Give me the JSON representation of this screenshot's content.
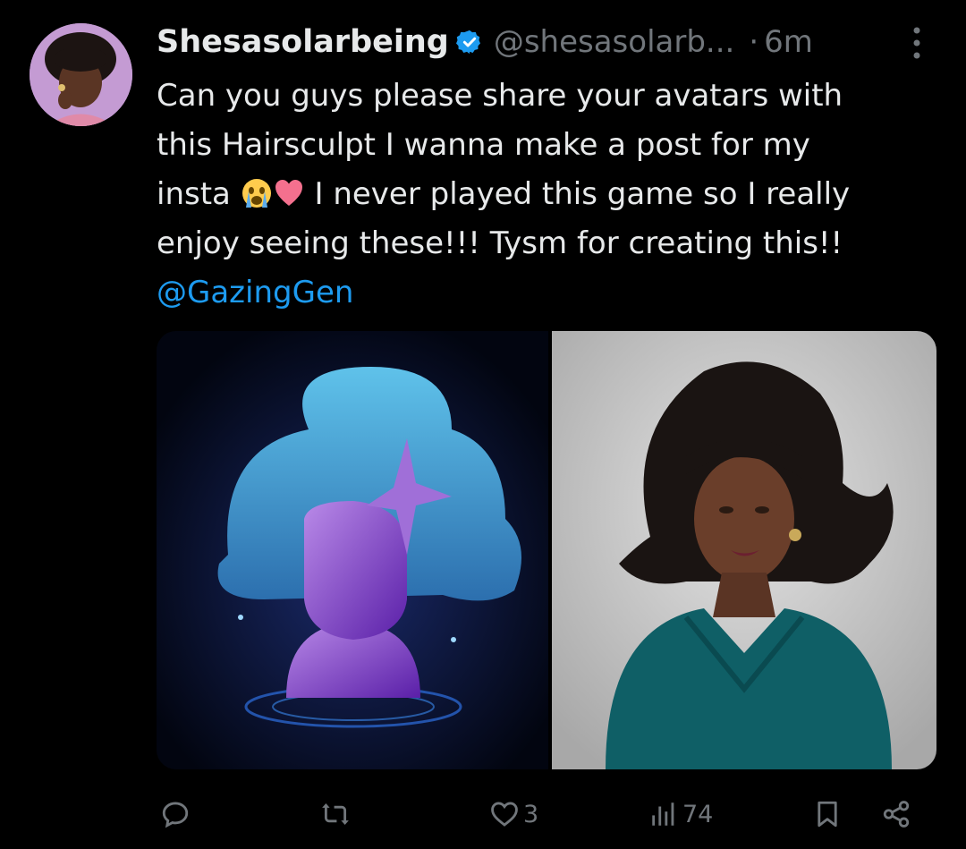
{
  "tweet": {
    "author": {
      "display_name": "Shesasolarbeing",
      "handle": "@shesasolarb...",
      "verified": true
    },
    "separator": "·",
    "time": "6m",
    "text": {
      "line1": "Can you guys please share your avatars with",
      "line2": "this Hairsculpt I wanna make a post for my",
      "line3_start": "insta ",
      "line3_end": " I never played this game so I really",
      "line4": "enjoy seeing these!!! Tysm for creating this!!",
      "mention": "@GazingGen"
    },
    "emojis": [
      "crying-face",
      "pink-heart"
    ],
    "actions": {
      "reply_count": "",
      "retweet_count": "",
      "like_count": "3",
      "view_count": "74"
    }
  },
  "colors": {
    "background": "#000000",
    "text": "#e7e9ea",
    "muted": "#71767b",
    "link": "#1d9bf0",
    "verified": "#1d9bf0"
  }
}
